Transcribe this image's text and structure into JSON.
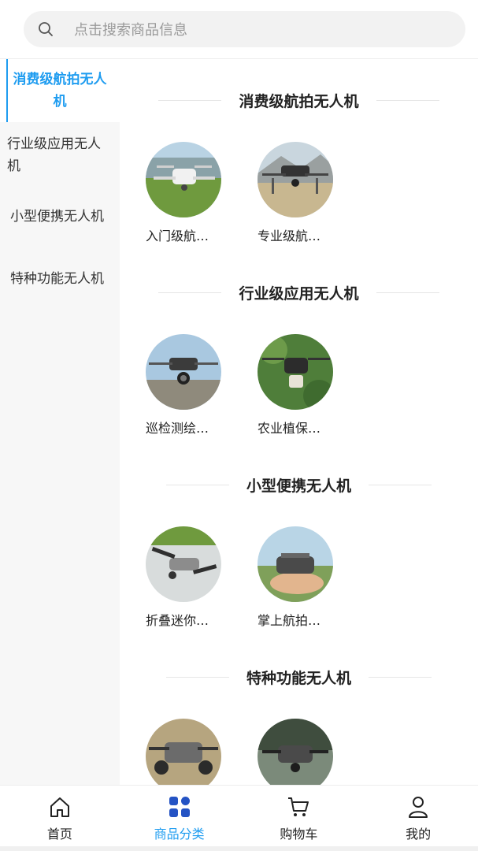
{
  "search": {
    "placeholder": "点击搜索商品信息"
  },
  "sidebar": {
    "items": [
      {
        "label_line1": "消费级航拍无人",
        "label_line2": "机"
      },
      {
        "label_line1": "行业级应用无人",
        "label_line2": "机"
      },
      {
        "label": "小型便携无人机"
      },
      {
        "label": "特种功能无人机"
      }
    ]
  },
  "sections": [
    {
      "title": "消费级航拍无人机",
      "items": [
        {
          "label": "入门级航…"
        },
        {
          "label": "专业级航…"
        }
      ]
    },
    {
      "title": "行业级应用无人机",
      "items": [
        {
          "label": "巡检测绘…"
        },
        {
          "label": "农业植保…"
        }
      ]
    },
    {
      "title": "小型便携无人机",
      "items": [
        {
          "label": "折叠迷你…"
        },
        {
          "label": "掌上航拍…"
        }
      ]
    },
    {
      "title": "特种功能无人机",
      "items": [
        {
          "label": ""
        },
        {
          "label": ""
        }
      ]
    }
  ],
  "tabbar": {
    "items": [
      {
        "label": "首页",
        "icon": "home-icon"
      },
      {
        "label": "商品分类",
        "icon": "category-icon"
      },
      {
        "label": "购物车",
        "icon": "cart-icon"
      },
      {
        "label": "我的",
        "icon": "user-icon"
      }
    ],
    "active_index": 1
  },
  "colors": {
    "accent": "#1e9cf0",
    "sidebar_bg": "#f7f7f7",
    "search_bg": "#f2f2f2"
  }
}
